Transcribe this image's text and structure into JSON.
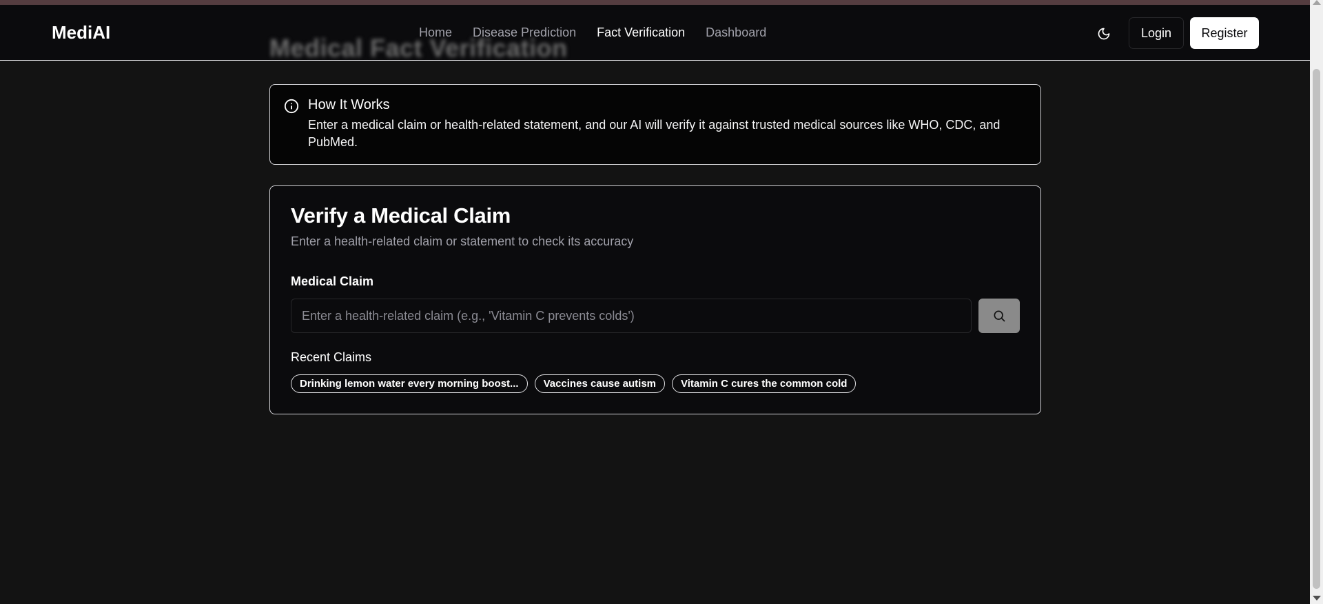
{
  "header": {
    "brand": "MediAI",
    "ghost_title": "Medical Fact Verification",
    "nav": [
      {
        "label": "Home",
        "active": false
      },
      {
        "label": "Disease Prediction",
        "active": false
      },
      {
        "label": "Fact Verification",
        "active": true
      },
      {
        "label": "Dashboard",
        "active": false
      }
    ],
    "theme_icon": "moon-icon",
    "login_label": "Login",
    "register_label": "Register"
  },
  "info": {
    "icon": "info-circle-icon",
    "title": "How It Works",
    "text": "Enter a medical claim or health-related statement, and our AI will verify it against trusted medical sources like WHO, CDC, and PubMed."
  },
  "verify": {
    "title": "Verify a Medical Claim",
    "subtitle": "Enter a health-related claim or statement to check its accuracy",
    "field_label": "Medical Claim",
    "input_value": "",
    "input_placeholder": "Enter a health-related claim (e.g., 'Vitamin C prevents colds')",
    "search_icon": "search-icon",
    "recent_label": "Recent Claims",
    "recent_claims": [
      "Drinking lemon water every morning boost...",
      "Vaccines cause autism",
      "Vitamin C cures the common cold"
    ]
  },
  "colors": {
    "background": "#131313",
    "card": "#0b0b0d",
    "text": "#fafafa",
    "muted": "#a1a1aa",
    "search_button": "#8a8a8a",
    "accent_strip": "#553d40"
  }
}
